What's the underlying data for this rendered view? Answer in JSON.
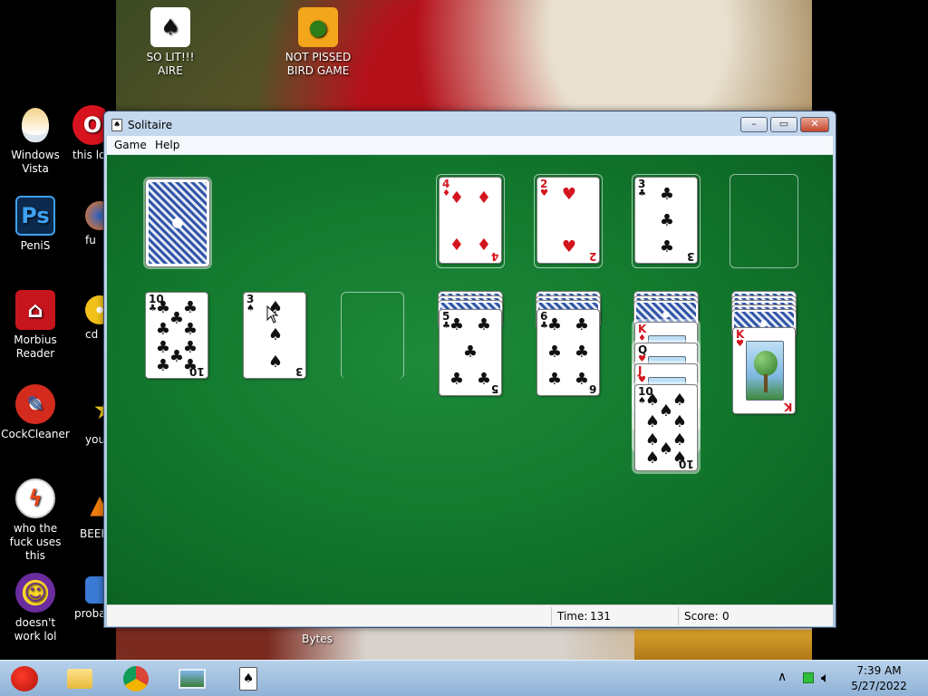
{
  "desktop": {
    "icons": [
      {
        "label": "SO LIT!!! AIRE",
        "icon": "solitaire-card-icon"
      },
      {
        "label": "NOT PISSED BIRD GAME",
        "icon": "green-pig-icon"
      },
      {
        "label": "Windows Vista",
        "icon": "egg-icon"
      },
      {
        "label": "this lo a vag",
        "icon": "opera-icon"
      },
      {
        "label": "PeniS",
        "icon": "photoshop-icon"
      },
      {
        "label": "fu",
        "icon": "firefox-icon"
      },
      {
        "label": "Morbius Reader",
        "icon": "acrobat-icon"
      },
      {
        "label": "cd",
        "icon": "disc-icon"
      },
      {
        "label": "CockCleaner",
        "icon": "ccleaner-icon"
      },
      {
        "label": "you",
        "icon": "star-icon"
      },
      {
        "label": "who the fuck uses this",
        "icon": "flash-icon"
      },
      {
        "label": "BEEF",
        "icon": "vlc-icon"
      },
      {
        "label": "doesn't work lol",
        "icon": "yahoo-messenger-icon"
      },
      {
        "label": "probab a rogue",
        "icon": "blue-app-icon"
      },
      {
        "label": "Bytes",
        "icon": "file-icon"
      }
    ]
  },
  "window": {
    "title": "Solitaire",
    "controls": {
      "minimize": "–",
      "maximize": "▭",
      "close": "✕"
    },
    "menu": [
      "Game",
      "Help"
    ],
    "status": {
      "time_label": "Time:",
      "time_value": "131",
      "score_label": "Score:",
      "score_value": "0"
    }
  },
  "game": {
    "foundations": [
      {
        "rank": "4",
        "suit": "♦",
        "color": "red"
      },
      {
        "rank": "2",
        "suit": "♥",
        "color": "red"
      },
      {
        "rank": "3",
        "suit": "♣",
        "color": "black"
      },
      {
        "rank": "",
        "suit": "",
        "color": "empty"
      }
    ],
    "tableau": [
      {
        "rank": "10",
        "suit": "♣",
        "color": "black"
      },
      {
        "rank": "3",
        "suit": "♠",
        "color": "black"
      },
      {
        "rank": "",
        "suit": "",
        "color": "empty"
      },
      {
        "rank": "5",
        "suit": "♣",
        "color": "black"
      },
      {
        "rank": "6",
        "suit": "♣",
        "color": "black"
      },
      {
        "rank": "K",
        "suit": "♦",
        "color": "red"
      },
      {
        "rank": "Q",
        "suit": "♥",
        "color": "red"
      },
      {
        "rank": "J",
        "suit": "♥",
        "color": "red"
      },
      {
        "rank": "10",
        "suit": "♠",
        "color": "black"
      },
      {
        "rank": "K",
        "suit": "♥",
        "color": "red"
      }
    ]
  },
  "taskbar": {
    "apps": [
      "angry-birds-icon",
      "folder-icon",
      "chrome-icon",
      "photos-icon",
      "solitaire-icon"
    ],
    "tray": {
      "time": "7:39 AM",
      "date": "5/27/2022"
    }
  },
  "colors": {
    "felt": "#137a2e",
    "red_suit": "#d3151e",
    "titlebar": "#c4d8ee"
  }
}
